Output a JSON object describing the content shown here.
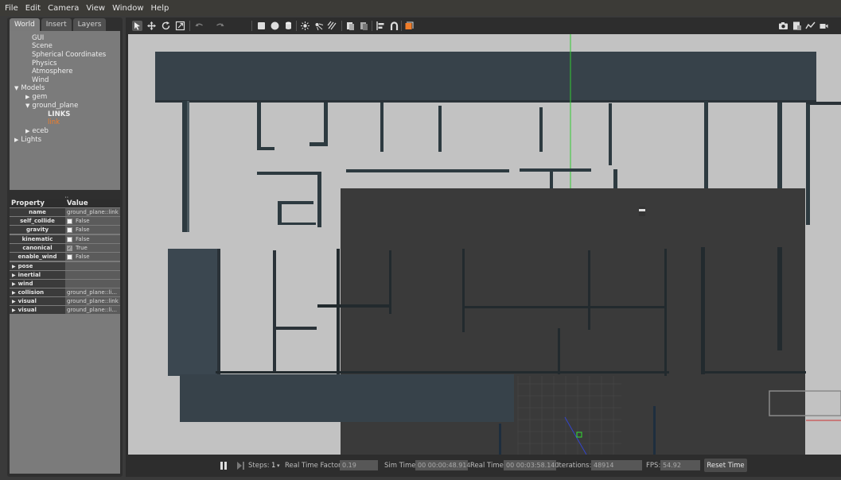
{
  "menu": [
    "File",
    "Edit",
    "Camera",
    "View",
    "Window",
    "Help"
  ],
  "left_panel": {
    "tabs": [
      "World",
      "Insert",
      "Layers"
    ],
    "tree": {
      "gui": "GUI",
      "scene": "Scene",
      "spherical": "Spherical Coordinates",
      "physics": "Physics",
      "atmosphere": "Atmosphere",
      "wind": "Wind",
      "models": "Models",
      "gem": "gem",
      "ground_plane": "ground_plane",
      "links": "LINKS",
      "link": "link",
      "eceb": "eceb",
      "lights": "Lights"
    },
    "properties": {
      "header_property": "Property",
      "header_value": "Value",
      "rows": [
        {
          "name": "name",
          "value": "ground_plane::link"
        },
        {
          "name": "self_collide",
          "value": "False"
        },
        {
          "name": "gravity",
          "value": "False"
        },
        {
          "name": "kinematic",
          "value": "False"
        },
        {
          "name": "canonical",
          "value": "True"
        },
        {
          "name": "enable_wind",
          "value": "False"
        }
      ],
      "groups": [
        {
          "name": "pose",
          "value": ""
        },
        {
          "name": "inertial",
          "value": ""
        },
        {
          "name": "wind",
          "value": ""
        },
        {
          "name": "collision",
          "value": "ground_plane::li..."
        },
        {
          "name": "visual",
          "value": "ground_plane::link"
        },
        {
          "name": "visual",
          "value": "ground_plane::li..."
        }
      ]
    }
  },
  "bottom_bar": {
    "steps_label": "Steps:",
    "steps_value": "1",
    "rtf_label": "Real Time Factor:",
    "rtf_value": "0.19",
    "sim_label": "Sim Time:",
    "sim_value": "00 00:00:48.914",
    "real_label": "Real Time:",
    "real_value": "00 00:03:58.140",
    "iter_label": "Iterations:",
    "iter_value": "48914",
    "fps_label": "FPS:",
    "fps_value": "54.92",
    "reset_label": "Reset Time"
  },
  "colors": {
    "orange": "#f07d2a",
    "wall_slate": "#37424a",
    "floor_dark": "#3a3a3a",
    "ground_light": "#c2c2c2"
  },
  "toolbar_icons": [
    "select-arrow-icon",
    "translate-icon",
    "rotate-icon",
    "scale-icon",
    "undo-icon",
    "redo-icon",
    "box-icon",
    "sphere-icon",
    "cylinder-icon",
    "point-light-icon",
    "spot-light-icon",
    "directional-light-icon",
    "copy-icon",
    "paste-icon",
    "align-icon",
    "snap-icon",
    "view-angle-icon",
    "screenshot-icon",
    "log-icon",
    "plot-icon",
    "record-icon"
  ]
}
